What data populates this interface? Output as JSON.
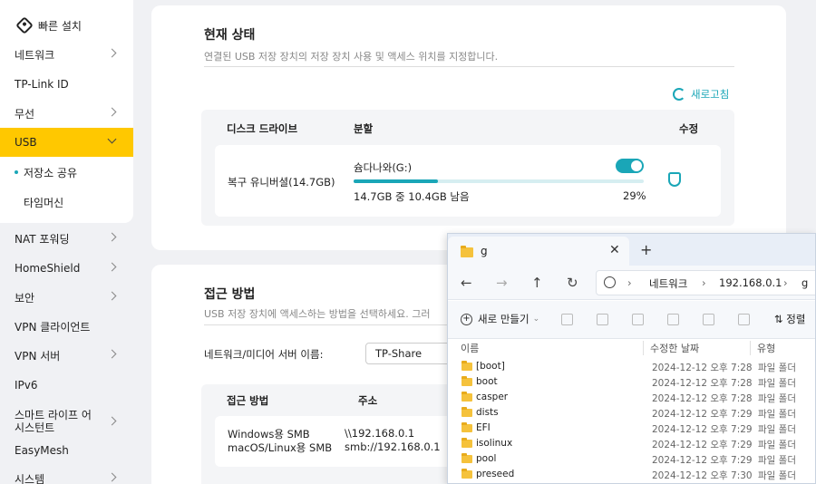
{
  "sidebar": {
    "quick_setup": "빠른 설치",
    "items": [
      {
        "label": "네트워크",
        "chevron": true
      },
      {
        "label": "TP-Link ID",
        "chevron": false
      },
      {
        "label": "무선",
        "chevron": true
      },
      {
        "label": "USB",
        "chevron": true,
        "active": true
      },
      {
        "label": "저장소 공유",
        "sub": true,
        "current": true
      },
      {
        "label": "타임머신",
        "sub": true
      },
      {
        "label": "NAT 포워딩",
        "chevron": true
      },
      {
        "label": "HomeShield",
        "chevron": true
      },
      {
        "label": "보안",
        "chevron": true
      },
      {
        "label": "VPN 클라이언트",
        "chevron": false
      },
      {
        "label": "VPN 서버",
        "chevron": true
      },
      {
        "label": "IPv6",
        "chevron": false
      },
      {
        "label": "스마트 라이프 어시스턴트",
        "chevron": true
      },
      {
        "label": "EasyMesh",
        "chevron": false
      },
      {
        "label": "시스템",
        "chevron": true
      }
    ]
  },
  "status": {
    "title": "현재 상태",
    "description": "연결된 USB 저장 장치의 저장 장치 사용 및 액세스 위치를 지정합니다.",
    "refresh": "새로고침",
    "columns": {
      "drive": "디스크 드라이브",
      "partition": "분할",
      "edit": "수정"
    },
    "drive_name": "복구 유니버셜(14.7GB)",
    "partition_name": "슘다나와(G:)",
    "usage_text": "14.7GB 중 10.4GB 남음",
    "usage_percent": "29%",
    "usage_fraction": 0.29,
    "enabled": true
  },
  "access": {
    "title": "접근 방법",
    "description": "USB 저장 장치에 액세스하는 방법을 선택하세요. 그러",
    "server_name_label": "네트워크/미디어 서버 이름:",
    "server_name_value": "TP-Share",
    "columns": {
      "method": "접근 방법",
      "address": "주소"
    },
    "methods": [
      "Windows용 SMB",
      "macOS/Linux용 SMB"
    ],
    "addresses": [
      "\\\\192.168.0.1",
      "smb://192.168.0.1"
    ]
  },
  "explorer": {
    "tab_title": "g",
    "close": "✕",
    "new_tab": "+",
    "breadcrumb": [
      "네트워크",
      "192.168.0.1",
      "g"
    ],
    "new_button": "새로 만들기",
    "sort_button": "정렬",
    "columns": {
      "name": "이름",
      "modified": "수정한 날짜",
      "type": "유형"
    },
    "files": [
      {
        "name": "[boot]",
        "date": "2024-12-12 오후 7:28",
        "type": "파일 폴더"
      },
      {
        "name": "boot",
        "date": "2024-12-12 오후 7:28",
        "type": "파일 폴더"
      },
      {
        "name": "casper",
        "date": "2024-12-12 오후 7:28",
        "type": "파일 폴더"
      },
      {
        "name": "dists",
        "date": "2024-12-12 오후 7:29",
        "type": "파일 폴더"
      },
      {
        "name": "EFI",
        "date": "2024-12-12 오후 7:29",
        "type": "파일 폴더"
      },
      {
        "name": "isolinux",
        "date": "2024-12-12 오후 7:29",
        "type": "파일 폴더"
      },
      {
        "name": "pool",
        "date": "2024-12-12 오후 7:29",
        "type": "파일 폴더"
      },
      {
        "name": "preseed",
        "date": "2024-12-12 오후 7:30",
        "type": "파일 폴더"
      }
    ]
  },
  "colors": {
    "accent": "#1aa6b7",
    "active": "#ffc800"
  }
}
